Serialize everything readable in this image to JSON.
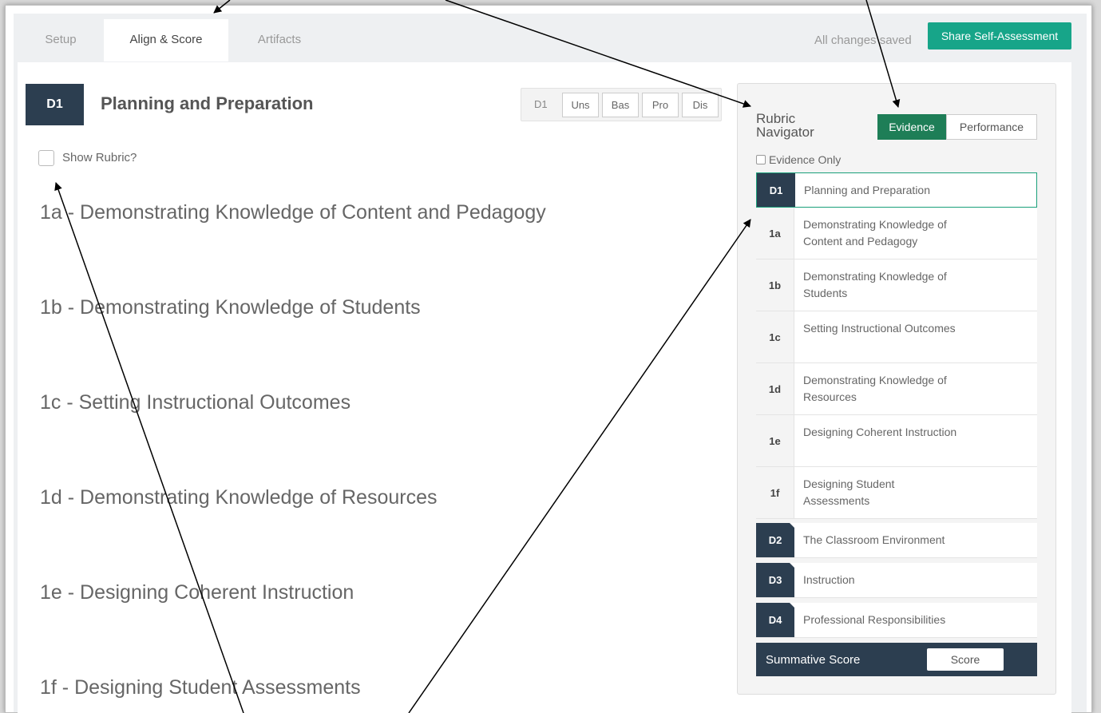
{
  "tabs": [
    {
      "label": "Setup",
      "active": false
    },
    {
      "label": "Align & Score",
      "active": true
    },
    {
      "label": "Artifacts",
      "active": false
    }
  ],
  "status": "All changes saved",
  "share_button": "Share Self-Assessment",
  "domain": {
    "code": "D1",
    "title": "Planning and Preparation"
  },
  "score_group": {
    "label": "D1",
    "buttons": [
      "Uns",
      "Bas",
      "Pro",
      "Dis"
    ]
  },
  "show_rubric": "Show Rubric?",
  "components": [
    "1a  -  Demonstrating Knowledge of Content and Pedagogy",
    "1b  -  Demonstrating Knowledge of Students",
    "1c  -  Setting Instructional Outcomes",
    "1d  -  Demonstrating Knowledge of Resources",
    "1e  -  Designing Coherent Instruction",
    "1f  -  Designing Student Assessments"
  ],
  "navigator": {
    "title": "Rubric Navigator",
    "toggle_on": "Evidence",
    "toggle_off": "Performance",
    "evidence_only": "Evidence Only",
    "items": [
      {
        "code": "D1",
        "label": "Planning and Preparation"
      },
      {
        "code": "1a",
        "label": "Demonstrating Knowledge of Content and Pedagogy"
      },
      {
        "code": "1b",
        "label": "Demonstrating Knowledge of Students"
      },
      {
        "code": "1c",
        "label": "Setting Instructional Outcomes"
      },
      {
        "code": "1d",
        "label": "Demonstrating Knowledge of Resources"
      },
      {
        "code": "1e",
        "label": "Designing Coherent Instruction"
      },
      {
        "code": "1f",
        "label": "Designing Student Assessments"
      },
      {
        "code": "D2",
        "label": "The Classroom Environment"
      },
      {
        "code": "D3",
        "label": "Instruction"
      },
      {
        "code": "D4",
        "label": "Professional Responsibilities"
      }
    ],
    "summative": {
      "label": "Summative Score",
      "button": "Score"
    }
  },
  "colors": {
    "accent": "#17a589",
    "dark": "#2c3e50",
    "toggle": "#1e7e57"
  }
}
